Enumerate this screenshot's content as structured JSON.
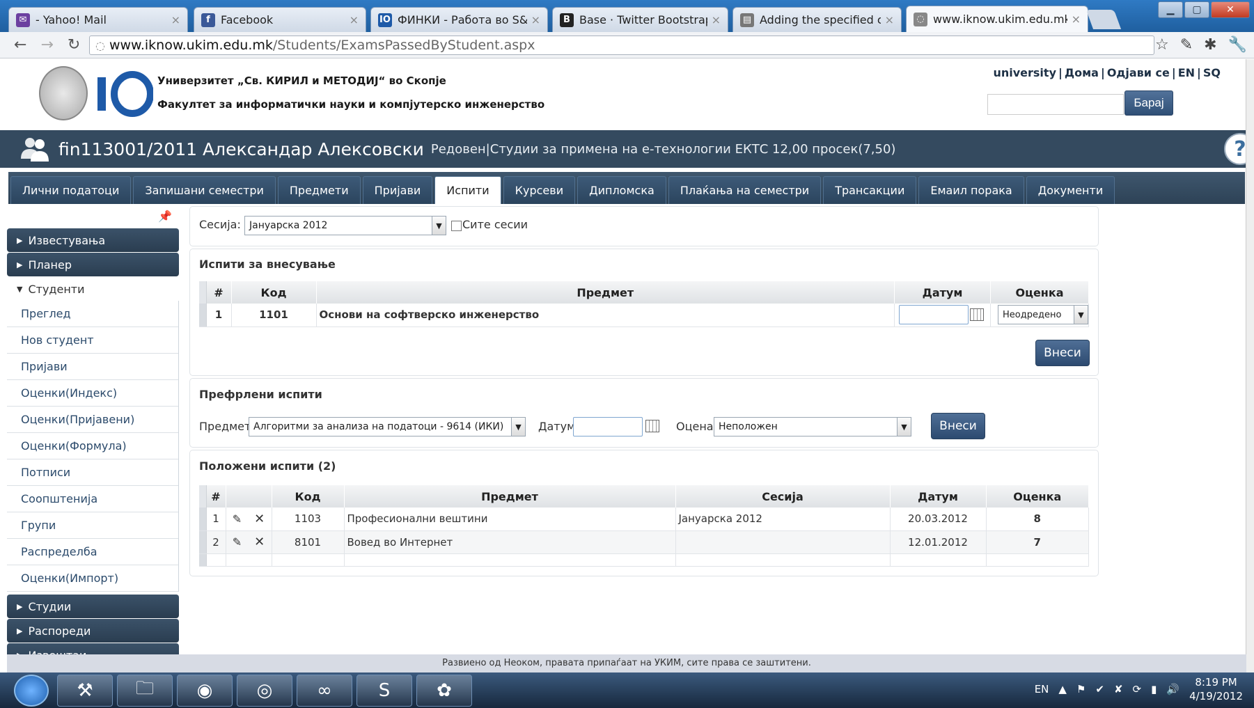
{
  "browser": {
    "tabs": [
      {
        "title": "- Yahoo! Mail",
        "icon": "mail-icon",
        "color": "#6b3fa0",
        "glyph": "✉"
      },
      {
        "title": "Facebook",
        "icon": "facebook-icon",
        "color": "#3b5998",
        "glyph": "f"
      },
      {
        "title": "ФИНКИ - Работа во S&T М",
        "icon": "io-icon",
        "color": "#1e5aa8",
        "glyph": "IO"
      },
      {
        "title": "Base · Twitter Bootstrap",
        "icon": "bootstrap-icon",
        "color": "#222222",
        "glyph": "B"
      },
      {
        "title": "Adding the specified count",
        "icon": "page-icon",
        "color": "#777777",
        "glyph": "▤"
      },
      {
        "title": "www.iknow.ukim.edu.mk/S",
        "icon": "globe-icon",
        "color": "#888888",
        "glyph": "◌"
      }
    ],
    "url_host": "www.iknow.ukim.edu.mk",
    "url_path": "/Students/ExamsPassedByStudent.aspx"
  },
  "header": {
    "university": "Универзитет „Св. КИРИЛ и МЕТОДИЈ“ во Скопје",
    "faculty": "Факултет за информатички науки и компјутерско инженерство",
    "links": [
      "university",
      "Дома",
      "Одјави се",
      "EN",
      "SQ"
    ],
    "search_button": "Барај"
  },
  "student": {
    "id_name": "fin113001/2011 Александар Алексовски",
    "info": "Редовен|Студии за примена на е-технологии ЕКТС 12,00 просек(7,50)"
  },
  "menu": {
    "tabs": [
      "Лични податоци",
      "Запишани семестри",
      "Предмети",
      "Пријави",
      "Испити",
      "Курсеви",
      "Дипломска",
      "Плаќања на семестри",
      "Трансакции",
      "Емаил порака",
      "Документи"
    ],
    "active": "Испити"
  },
  "sidebar": {
    "top_sections": [
      "Известувања",
      "Планер"
    ],
    "open_section": "Студенти",
    "items": [
      "Преглед",
      "Нов студент",
      "Пријави",
      "Оценки(Индекс)",
      "Оценки(Пријавени)",
      "Оценки(Формула)",
      "Потписи",
      "Соопштенија",
      "Групи",
      "Распределба",
      "Оценки(Импорт)"
    ],
    "bottom_sections": [
      "Студии",
      "Распореди",
      "Извештаи"
    ]
  },
  "session": {
    "label": "Сесија:",
    "value": "Јануарска 2012",
    "all_sessions": "Сите сесии"
  },
  "exams_to_enter": {
    "title": "Испити за внесување",
    "headers": [
      "#",
      "Код",
      "Предмет",
      "Датум",
      "Оценка"
    ],
    "rows": [
      {
        "num": "1",
        "code": "1101",
        "subject": "Основи на софтверско инженерство",
        "grade": "Неодредено"
      }
    ],
    "submit": "Внеси"
  },
  "transferred": {
    "title": "Префрлени испити",
    "subject_label": "Предмет",
    "subject_value": "Алгоритми за анализа на податоци - 9614 (ИКИ)",
    "date_label": "Датум",
    "grade_label": "Оцена",
    "grade_value": "Неположен",
    "submit": "Внеси"
  },
  "passed": {
    "title": "Положени испити (2)",
    "headers": [
      "#",
      "Код",
      "Предмет",
      "Сесија",
      "Датум",
      "Оценка"
    ],
    "rows": [
      {
        "num": "1",
        "code": "1103",
        "subject": "Професионални вештини",
        "session": "Јануарска 2012",
        "date": "20.03.2012",
        "grade": "8"
      },
      {
        "num": "2",
        "code": "8101",
        "subject": "Вовед во Интернет",
        "session": "",
        "date": "12.01.2012",
        "grade": "7"
      }
    ]
  },
  "footer": "Развиено од Неоком, правата припаѓаат на УКИМ, сите права се заштитени.",
  "taskbar": {
    "lang": "EN",
    "time": "8:19 PM",
    "date": "4/19/2012"
  }
}
